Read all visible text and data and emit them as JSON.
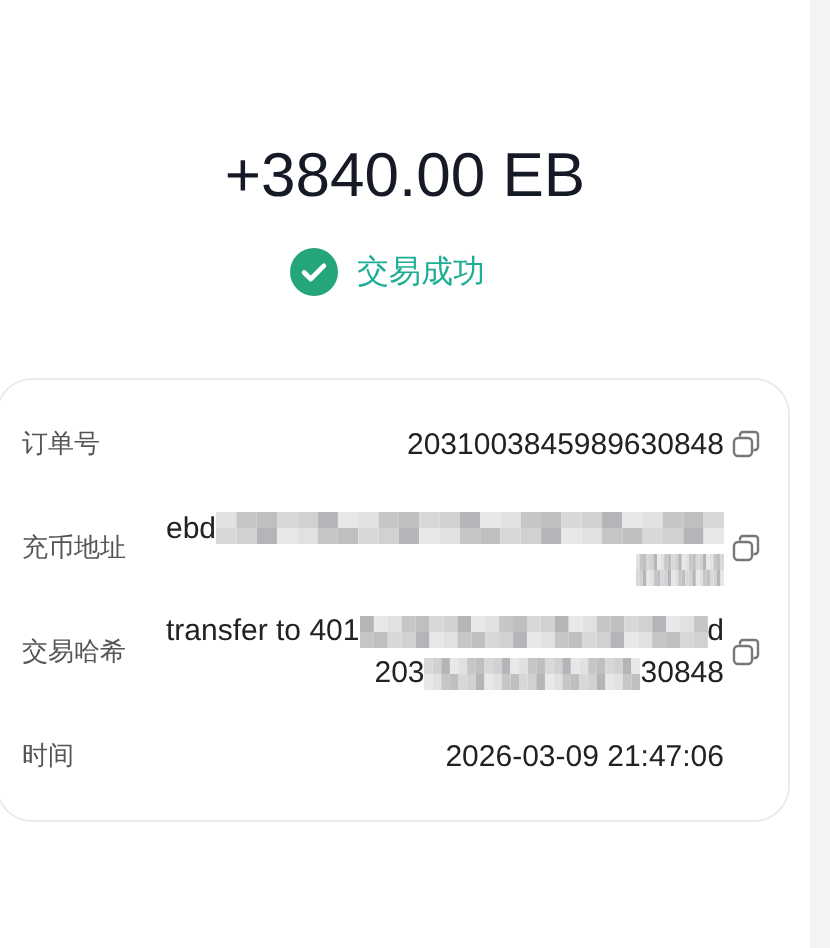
{
  "amount": "+3840.00 EB",
  "status": {
    "text": "交易成功",
    "kind": "success"
  },
  "details": [
    {
      "label": "订单号",
      "copyable": true,
      "lines": [
        [
          {
            "kind": "text",
            "text": "2031003845989630848"
          }
        ]
      ]
    },
    {
      "label": "充币地址",
      "copyable": true,
      "lines": [
        [
          {
            "kind": "text",
            "text": "ebd"
          },
          {
            "kind": "redaction"
          }
        ],
        [
          {
            "kind": "redaction"
          }
        ]
      ]
    },
    {
      "label": "交易哈希",
      "copyable": true,
      "lines": [
        [
          {
            "kind": "text",
            "text": "transfer to 401"
          },
          {
            "kind": "redaction"
          },
          {
            "kind": "text",
            "text": "d"
          }
        ],
        [
          {
            "kind": "text",
            "text": "203"
          },
          {
            "kind": "redaction"
          },
          {
            "kind": "text",
            "text": "30848"
          }
        ]
      ]
    },
    {
      "label": "时间",
      "copyable": false,
      "lines": [
        [
          {
            "kind": "text",
            "text": "2026-03-09 21:47:06"
          }
        ]
      ]
    }
  ]
}
